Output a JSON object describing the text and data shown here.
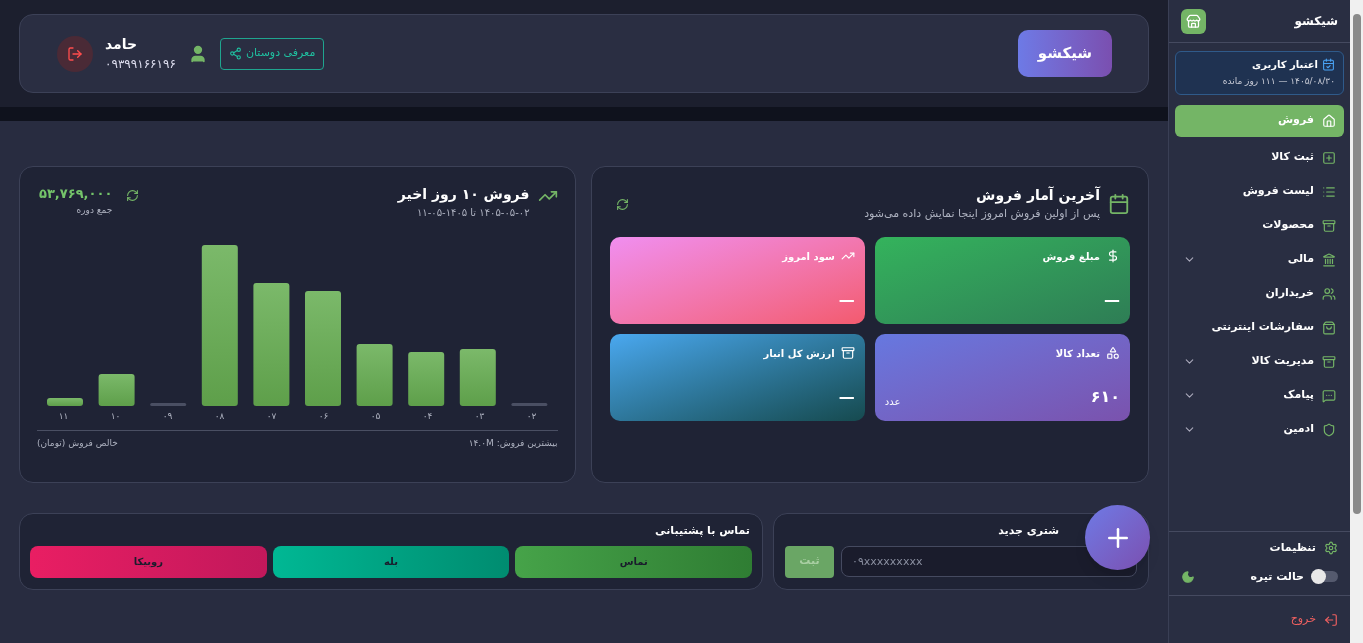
{
  "sidebar": {
    "brand": "شیکشو",
    "credit": {
      "title": "اعتبار کاربری",
      "subtitle": "۱۴۰۵/۰۸/۳۰ — ۱۱۱ روز مانده"
    },
    "items": [
      {
        "kind": "home",
        "label": "فروش",
        "selected": true,
        "expandable": false
      },
      {
        "kind": "add",
        "label": "ثبت کالا",
        "selected": false,
        "expandable": false
      },
      {
        "kind": "list",
        "label": "لیست فروش",
        "selected": false,
        "expandable": false
      },
      {
        "kind": "archive",
        "label": "محصولات",
        "selected": false,
        "expandable": false
      },
      {
        "kind": "bank",
        "label": "مالی",
        "selected": false,
        "expandable": true
      },
      {
        "kind": "users",
        "label": "خریداران",
        "selected": false,
        "expandable": false
      },
      {
        "kind": "bag",
        "label": "سفارشات اینترنتی",
        "selected": false,
        "expandable": false
      },
      {
        "kind": "archive",
        "label": "مدیریت کالا",
        "selected": false,
        "expandable": true
      },
      {
        "kind": "chat",
        "label": "پیامک",
        "selected": false,
        "expandable": true
      },
      {
        "kind": "shield",
        "label": "ادمین",
        "selected": false,
        "expandable": true
      }
    ],
    "settings": "تنظیمات",
    "dark_mode": {
      "label": "حالت تیره",
      "on": false
    },
    "logout": "خروج"
  },
  "header": {
    "logo": "شیکشو",
    "referral": "معرفی دوستان",
    "user_name": "حامد",
    "phone": "۰۹۳۹۹۱۶۶۱۹۶"
  },
  "stats": {
    "title": "آخرین آمار فروش",
    "subtitle": "پس از اولین فروش امروز اینجا نمایش داده می‌شود",
    "tiles": [
      {
        "kind": "sales",
        "label": "مبلغ فروش",
        "value": "—"
      },
      {
        "kind": "profit",
        "label": "سود امروز",
        "value": "—"
      },
      {
        "kind": "count",
        "label": "تعداد کالا",
        "value": "۶۱۰",
        "unit": "عدد"
      },
      {
        "kind": "inventory",
        "label": "ارزش کل انبار",
        "value": "—"
      }
    ]
  },
  "sales_chart": {
    "title": "فروش ۱۰ روز اخیر",
    "range": "۱۴۰۵-۰۵-۰۲ تا ۱۴۰۵-۰۵-۱۱",
    "total": "۵۳,۷۶۹,۰۰۰",
    "total_label": "جمع دوره",
    "days": [
      "۰۲",
      "۰۳",
      "۰۴",
      "۰۵",
      "۰۶",
      "۰۷",
      "۰۸",
      "۰۹",
      "۱۰",
      "۱۱"
    ],
    "max_note": "بیشترین فروش: ۱۴.۰M",
    "legend": "خالص فروش (تومان)"
  },
  "new_customer": {
    "title": "شتری جدید",
    "placeholder": "۰۹xxxxxxxxx",
    "submit": {
      "label": "ثبت",
      "disabled": true
    }
  },
  "support": {
    "title": "تماس با پشتیبانی",
    "buttons": [
      {
        "kind": "call",
        "label": "تماس"
      },
      {
        "kind": "bale",
        "label": "بله"
      },
      {
        "kind": "rubika",
        "label": "روبیکا"
      }
    ]
  }
}
